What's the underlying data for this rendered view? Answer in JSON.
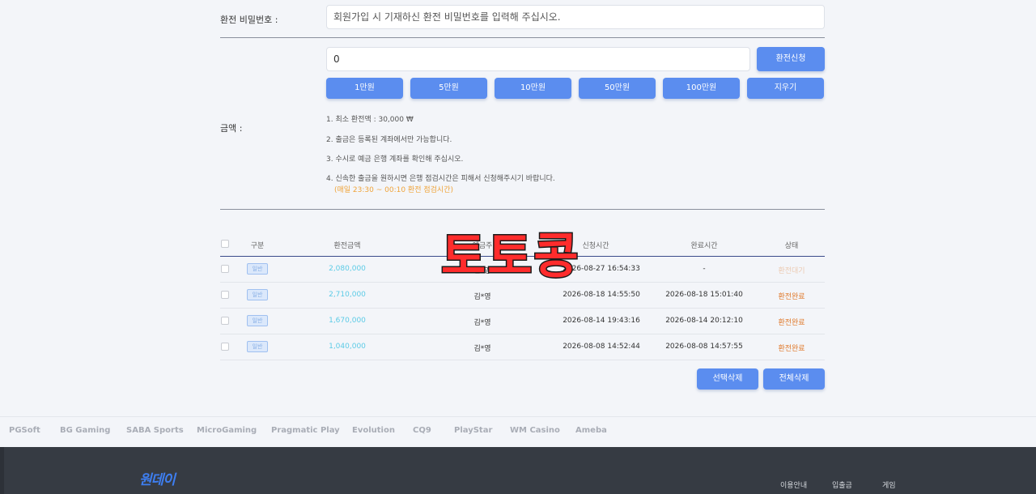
{
  "form": {
    "password_label": "환전 비밀번호 :",
    "password_placeholder": "회원가입 시 기재하신 환전 비밀번호를 입력해 주십시오.",
    "amount_label": "금액 :",
    "amount_value": "0",
    "submit_label": "환전신청",
    "quick_buttons": [
      "1만원",
      "5만원",
      "10만원",
      "50만원",
      "100만원",
      "지우기"
    ],
    "notices": [
      "1. 최소 환전액 : 30,000 ₩",
      "2. 출금은 등록된 계좌에서만 가능합니다.",
      "3. 수시로 예금 은행 계좌를 확인해 주십시오.",
      "4. 신속한 출금을 원하시면 은행 점검시간은 피해서 신청해주시기 바랍니다."
    ],
    "notice_warn": "(매일 23:30 ~ 00:10 환전 점검시간)"
  },
  "table": {
    "headers": {
      "type": "구분",
      "amount": "환전금액",
      "holder": "예금주",
      "request_time": "신청시간",
      "complete_time": "완료시간",
      "status": "상태"
    },
    "rows": [
      {
        "type": "일반",
        "amount": "2,080,000",
        "holder": "김*영",
        "request_time": "2026-08-27 16:54:33",
        "complete_time": "-",
        "status": "환전대기"
      },
      {
        "type": "일반",
        "amount": "2,710,000",
        "holder": "김*영",
        "request_time": "2026-08-18 14:55:50",
        "complete_time": "2026-08-18 15:01:40",
        "status": "환전완료"
      },
      {
        "type": "일반",
        "amount": "1,670,000",
        "holder": "김*영",
        "request_time": "2026-08-14 19:43:16",
        "complete_time": "2026-08-14 20:12:10",
        "status": "환전완료"
      },
      {
        "type": "일반",
        "amount": "1,040,000",
        "holder": "김*영",
        "request_time": "2026-08-08 14:52:44",
        "complete_time": "2026-08-08 14:57:55",
        "status": "환전완료"
      }
    ],
    "delete_selected_label": "선택삭제",
    "delete_all_label": "전체삭제"
  },
  "brands": [
    "PGSoft",
    "BG Gaming",
    "SABA Sports",
    "MicroGaming",
    "Pragmatic Play",
    "Evolution",
    "CQ9",
    "PlayStar",
    "WM Casino",
    "Ameba"
  ],
  "footer": {
    "logo": "원데이",
    "nav": [
      "이용안내",
      "입출금",
      "게임"
    ]
  },
  "watermark": "토토콩",
  "colors": {
    "accent": "#5b8def",
    "amount_text": "#5ccbe6",
    "status_done": "#e07a2c",
    "notice_warn": "#f0a43a",
    "footer_bg": "#363b43"
  }
}
